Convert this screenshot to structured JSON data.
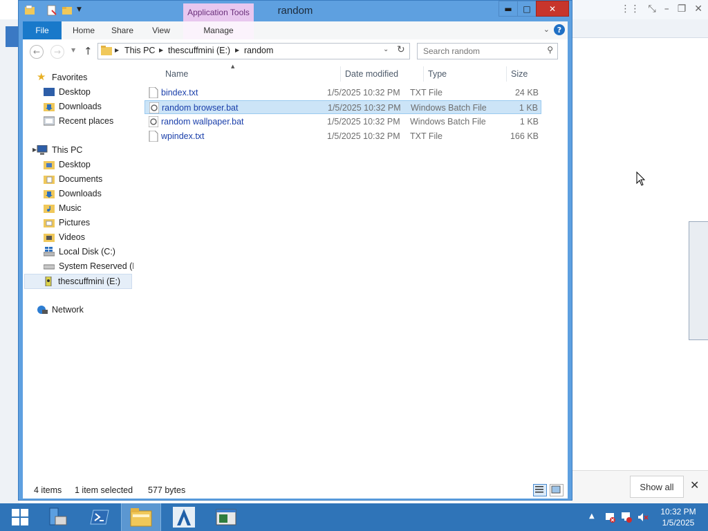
{
  "window": {
    "title": "random",
    "context_tab_group": "Application Tools",
    "min_label": "▬",
    "max_label": "□",
    "close_label": "✕"
  },
  "ribbon": {
    "tabs": [
      "File",
      "Home",
      "Share",
      "View",
      "Manage"
    ],
    "help_label": "?"
  },
  "address": {
    "crumbs": [
      "This PC",
      "thescuffmini (E:)",
      "random"
    ],
    "search_placeholder": "Search random"
  },
  "nav": {
    "favorites_label": "Favorites",
    "favorites": [
      "Desktop",
      "Downloads",
      "Recent places"
    ],
    "thispc_label": "This PC",
    "thispc": [
      "Desktop",
      "Documents",
      "Downloads",
      "Music",
      "Pictures",
      "Videos",
      "Local Disk (C:)",
      "System Reserved (D:",
      "thescuffmini (E:)"
    ],
    "network_label": "Network"
  },
  "columns": {
    "name": "Name",
    "date": "Date modified",
    "type": "Type",
    "size": "Size"
  },
  "files": [
    {
      "name": "bindex.txt",
      "date": "1/5/2025 10:32 PM",
      "type": "TXT File",
      "size": "24 KB"
    },
    {
      "name": "random browser.bat",
      "date": "1/5/2025 10:32 PM",
      "type": "Windows Batch File",
      "size": "1 KB"
    },
    {
      "name": "random wallpaper.bat",
      "date": "1/5/2025 10:32 PM",
      "type": "Windows Batch File",
      "size": "1 KB"
    },
    {
      "name": "wpindex.txt",
      "date": "1/5/2025 10:32 PM",
      "type": "TXT File",
      "size": "166 KB"
    }
  ],
  "status": {
    "items": "4 items",
    "selection": "1 item selected",
    "bytes": "577 bytes"
  },
  "background_window": {
    "show_all_label": "Show all",
    "close_label": "✕"
  },
  "clock": {
    "time": "10:32 PM",
    "date": "1/5/2025"
  },
  "colors": {
    "window_frame": "#5ea0e0",
    "file_tab": "#1979ca",
    "selection": "#cce4f7",
    "taskbar": "#2f74b8",
    "close_button": "#c7352c",
    "context_tab": "#e8c7ef"
  }
}
